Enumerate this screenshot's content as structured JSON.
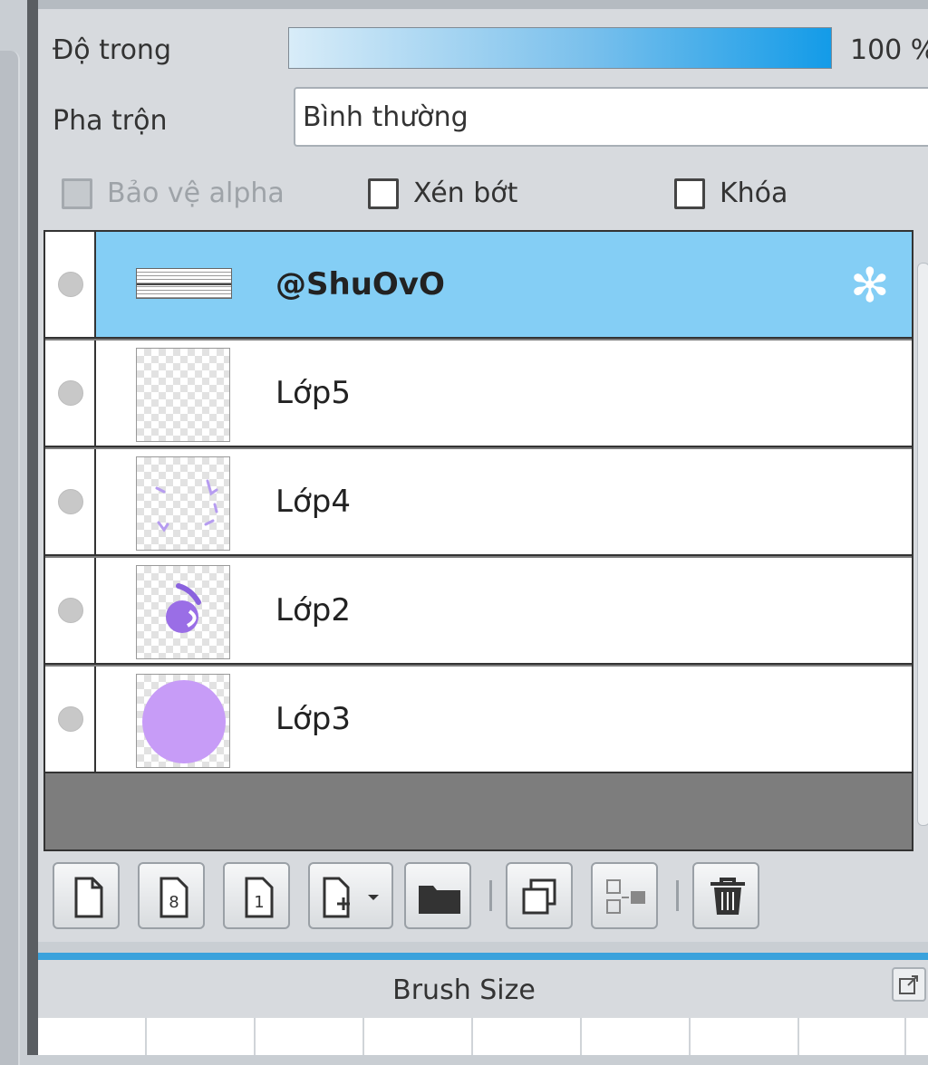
{
  "layer_properties": {
    "opacity_label": "Độ trong",
    "opacity_value": "100 %",
    "opacity_fraction": 1.0,
    "blend_label": "Pha trộn",
    "blend_mode": "Bình thường",
    "protect_alpha_label": "Bảo vệ alpha",
    "clipping_label": "Xén bớt",
    "lock_label": "Khóa"
  },
  "layers": [
    {
      "name": "@ShuOvO",
      "selected": true,
      "thumb_text": "@ShuOvO #HoiDapi247"
    },
    {
      "name": "Lớp5",
      "selected": false
    },
    {
      "name": "Lớp4",
      "selected": false
    },
    {
      "name": "Lớp2",
      "selected": false
    },
    {
      "name": "Lớp3",
      "selected": false
    }
  ],
  "toolbar": {
    "buttons": [
      "new-layer",
      "new-8bit-layer",
      "new-1bit-layer",
      "add-layer-menu",
      "new-folder",
      "duplicate-layer",
      "merge-down",
      "delete-layer"
    ],
    "new_8bit_label": "8",
    "new_1bit_label": "1"
  },
  "brush_panel": {
    "title": "Brush Size"
  },
  "colors": {
    "selected_row": "#84cef5",
    "opacity_gradient_end": "#139be8",
    "thumb_purple": "#c79cf7"
  }
}
